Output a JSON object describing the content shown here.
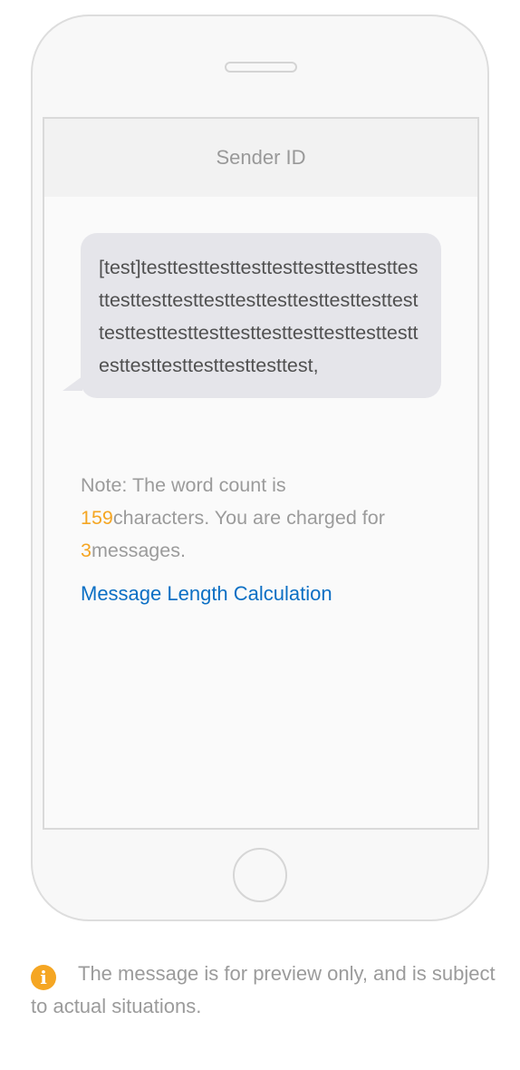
{
  "screen": {
    "header_title": "Sender ID"
  },
  "message": {
    "text": "[test]testtesttesttesttesttesttesttesttesttesttesttesttesttesttesttesttesttesttesttesttesttesttesttesttesttesttesttesttesttesttesttesttesttesttesttest,"
  },
  "note": {
    "prefix": "Note: The word count is ",
    "char_count": "159",
    "mid": "characters. You are charged for ",
    "message_count": "3",
    "suffix": "messages."
  },
  "link": {
    "label": "Message Length Calculation"
  },
  "footer": {
    "icon": "info-icon",
    "text": "The message is for preview only, and is subject to actual situations."
  },
  "colors": {
    "accent": "#f5a623",
    "link": "#0b6fc4",
    "muted_text": "#9b9b9b",
    "bubble": "#e5e5ea"
  }
}
